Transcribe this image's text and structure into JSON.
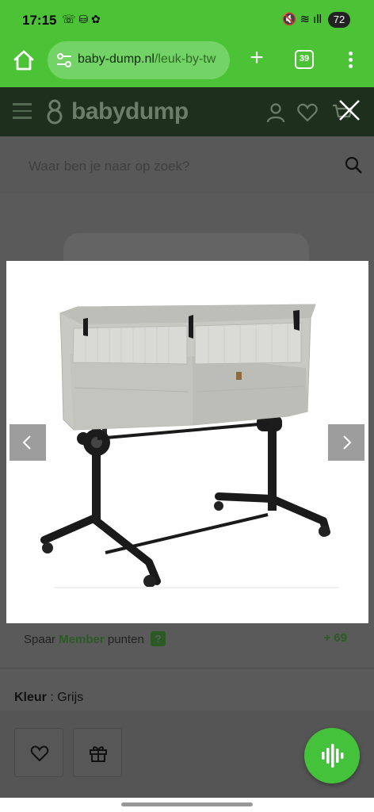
{
  "status": {
    "time": "17:15",
    "left_icons": "☏ ⛁ ✿",
    "right_icons": "🔇 ≋ ıll",
    "battery": "72"
  },
  "browser": {
    "url_domain": "baby-dump.nl",
    "url_path": "/leuk-by-tw",
    "tab_count": "39",
    "plus": "+"
  },
  "site": {
    "logo_text": "babydump",
    "search_placeholder": "Waar ben je naar op zoek?"
  },
  "product": {
    "points_prefix": "Spaar",
    "points_member": "Member",
    "points_suffix": "punten",
    "points_help": "?",
    "points_value": "+ 69",
    "color_label": "Kleur",
    "color_sep": ":",
    "color_value": "Grijs"
  },
  "colors": {
    "brand_green": "#4cc236",
    "fab_green": "#44c23b"
  }
}
